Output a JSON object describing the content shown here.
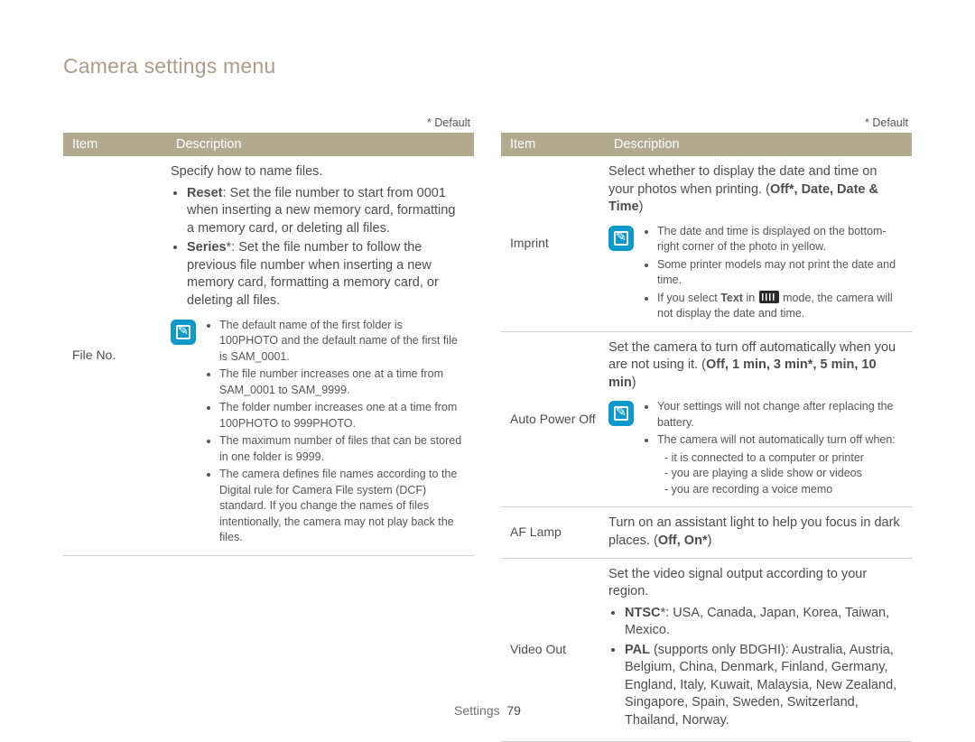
{
  "title": "Camera settings menu",
  "default_note": "* Default",
  "headers": {
    "item": "Item",
    "description": "Description"
  },
  "footer": {
    "section": "Settings",
    "page": "79"
  },
  "left": {
    "rows": [
      {
        "item": "File No.",
        "intro": "Specify how to name files.",
        "bullets": [
          {
            "lead": "Reset",
            "text": ": Set the file number to start from 0001 when inserting a new memory card, formatting a memory card, or deleting all files."
          },
          {
            "lead": "Series",
            "suffix": "*",
            "text": ": Set the file number to follow the previous file number when inserting a new memory card, formatting a memory card, or deleting all files."
          }
        ],
        "notes": [
          "The default name of the first folder is 100PHOTO and the default name of the first file is SAM_0001.",
          "The file number increases one at a time from SAM_0001 to SAM_9999.",
          "The folder number increases one at a time from 100PHOTO to 999PHOTO.",
          "The maximum number of files that can be stored in one folder is 9999.",
          "The camera defines file names according to the Digital rule for Camera File system (DCF) standard. If you change the names of files intentionally, the camera may not play back the files."
        ]
      }
    ]
  },
  "right": {
    "rows": [
      {
        "item": "Imprint",
        "intro_pre": "Select whether to display the date and time on your photos when printing. (",
        "options": "Off*, Date, Date & Time",
        "intro_post": ")",
        "notes": [
          "The date and time is displayed on the bottom-right corner of the photo in yellow.",
          "Some printer models may not print the date and time.",
          {
            "pre": "If you select ",
            "bold": "Text",
            "mid": " in ",
            "icon": true,
            "post": " mode, the camera will not display the date and time."
          }
        ]
      },
      {
        "item": "Auto Power Off",
        "intro_pre": "Set the camera to turn off automatically when you are not using it. (",
        "options": "Off, 1 min, 3 min*, 5 min, 10 min",
        "intro_post": ")",
        "notes": [
          "Your settings will not change after replacing the battery.",
          {
            "text": "The camera will not automatically turn off when:",
            "sub": [
              "it is connected to a computer or printer",
              "you are playing a slide show or videos",
              "you are recording a voice memo"
            ]
          }
        ]
      },
      {
        "item": "AF Lamp",
        "intro_pre": "Turn on an assistant light to help you focus in dark places. (",
        "options": "Off, On*",
        "intro_post": ")"
      },
      {
        "item": "Video Out",
        "intro": "Set the video signal output according to your region.",
        "bullets": [
          {
            "lead": "NTSC",
            "suffix": "*",
            "text": ": USA, Canada, Japan, Korea, Taiwan, Mexico."
          },
          {
            "lead": "PAL",
            "text": " (supports only BDGHI): Australia, Austria, Belgium, China, Denmark, Finland, Germany, England, Italy, Kuwait, Malaysia, New Zealand, Singapore, Spain, Sweden, Switzerland, Thailand, Norway."
          }
        ]
      }
    ]
  }
}
